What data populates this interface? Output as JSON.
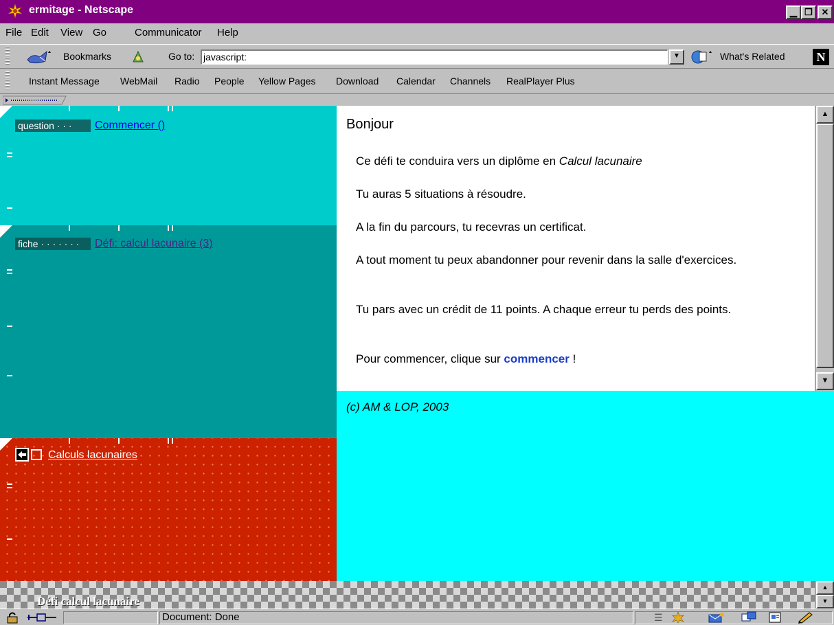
{
  "window": {
    "title": "ermitage - Netscape"
  },
  "menubar": {
    "items": [
      {
        "label": "File"
      },
      {
        "label": "Edit"
      },
      {
        "label": "View"
      },
      {
        "label": "Go"
      },
      {
        "label": "Communicator"
      },
      {
        "label": "Help"
      }
    ]
  },
  "location_toolbar": {
    "bookmarks_label": "Bookmarks",
    "goto_label": "Go to:",
    "url_value": "javascript:",
    "whats_related_label": "What's Related"
  },
  "personal_toolbar": {
    "items": [
      {
        "label": "Instant Message"
      },
      {
        "label": "WebMail"
      },
      {
        "label": "Radio"
      },
      {
        "label": "People"
      },
      {
        "label": "Yellow Pages"
      },
      {
        "label": "Download"
      },
      {
        "label": "Calendar"
      },
      {
        "label": "Channels"
      },
      {
        "label": "RealPlayer Plus"
      }
    ]
  },
  "left_frames": {
    "question": {
      "tag": "question · · ·",
      "link": "Commencer ()"
    },
    "fiche": {
      "tag": "fiche · · · · · · ·",
      "link": "Défi: calcul lacunaire (3)"
    },
    "nav": {
      "link": "Calculs lacunaires"
    }
  },
  "content": {
    "heading": "Bonjour",
    "paragraphs": {
      "p1_before": "Ce défi te conduira vers un diplôme en ",
      "p1_italic": "Calcul lacunaire",
      "p2": "Tu auras 5 situations à résoudre.",
      "p3": "A la fin du parcours, tu recevras un certificat.",
      "p4": "A tout moment tu peux abandonner pour revenir dans la salle d'exercices.",
      "p5": "Tu pars avec un crédit de 11 points. A chaque erreur tu perds des points.",
      "p6_before": "Pour commencer, clique sur ",
      "p6_link": "commencer",
      "p6_after": " !"
    }
  },
  "footer_frame": {
    "copyright": "(c) AM & LOP, 2003"
  },
  "banner": {
    "text": "Défi calcul lacunaire"
  },
  "statusbar": {
    "text": "Document: Done"
  },
  "colors": {
    "titlebar": "#800080",
    "frame_question": "#00cccc",
    "frame_fiche": "#009999",
    "frame_nav": "#cc2200",
    "footer": "#00ffff",
    "link_visited": "#551a8b",
    "link_unvisited": "#0000ee"
  }
}
